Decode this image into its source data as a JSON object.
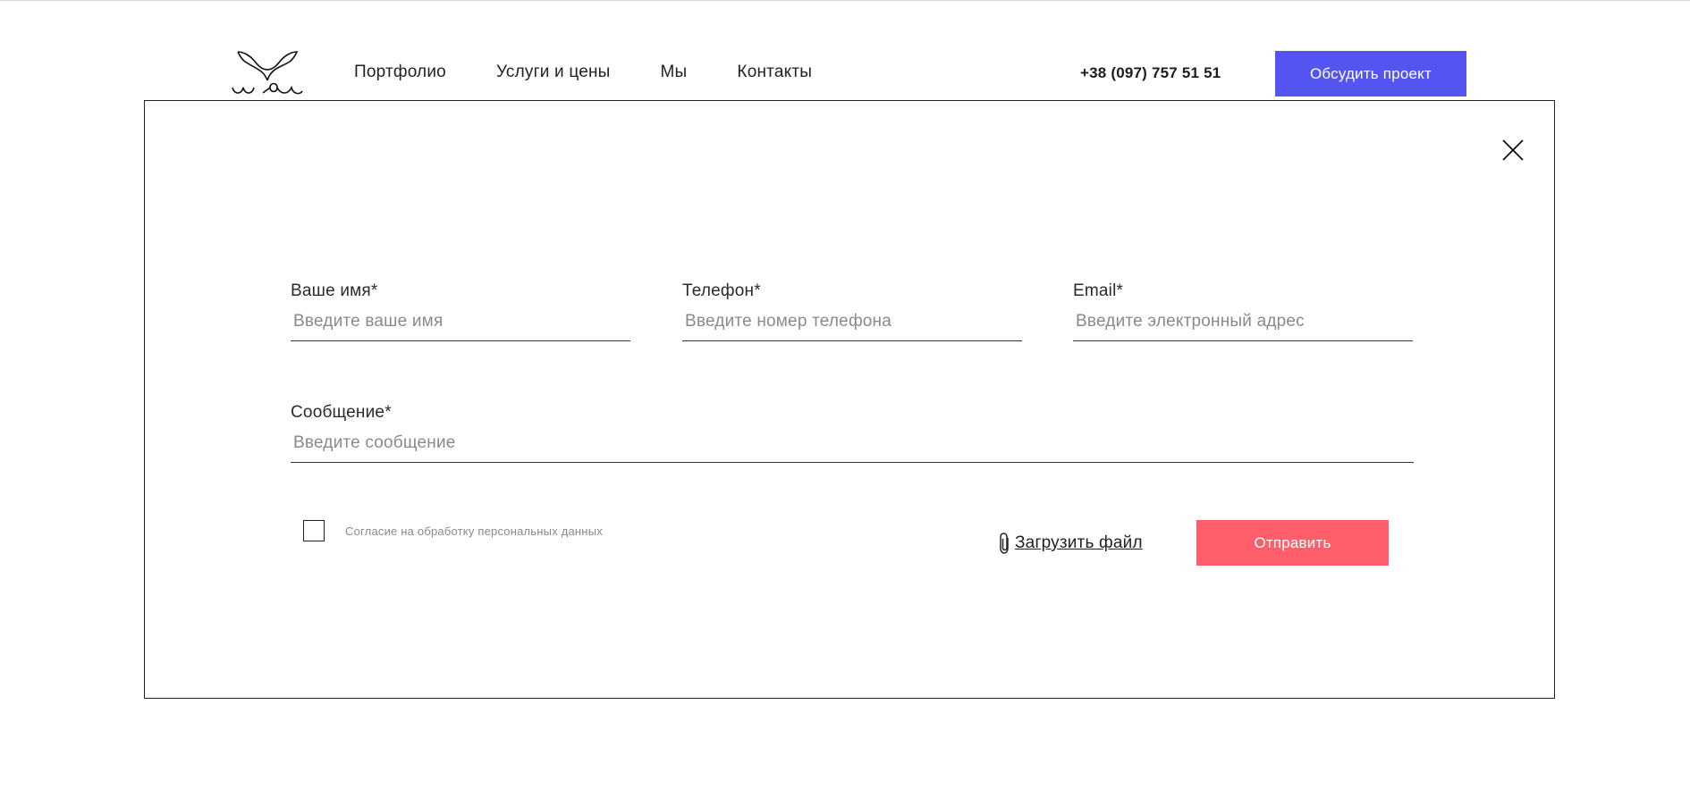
{
  "header": {
    "logo_icon": "whale-tail-logo-icon",
    "nav": [
      {
        "label": "Портфолио"
      },
      {
        "label": "Услуги и цены"
      },
      {
        "label": "Мы"
      },
      {
        "label": "Контакты"
      }
    ],
    "phone": "+38 (097) 757 51 51",
    "cta_label": "Обсудить проект",
    "cta_color": "#5454f1"
  },
  "modal": {
    "close_icon": "close-icon",
    "fields": {
      "name": {
        "label": "Ваше имя*",
        "placeholder": "Введите ваше имя",
        "value": ""
      },
      "phone": {
        "label": "Телефон*",
        "placeholder": "Введите номер телефона",
        "value": ""
      },
      "email": {
        "label": "Email*",
        "placeholder": "Введите электронный адрес",
        "value": ""
      },
      "message": {
        "label": "Сообщение*",
        "placeholder": "Введите сообщение",
        "value": ""
      }
    },
    "consent": {
      "label": "Согласие на обработку персональных данных",
      "checked": false
    },
    "upload": {
      "icon": "paperclip-icon",
      "label": "Загрузить файл"
    },
    "submit_label": "Отправить",
    "submit_color": "#ff5e6a"
  }
}
